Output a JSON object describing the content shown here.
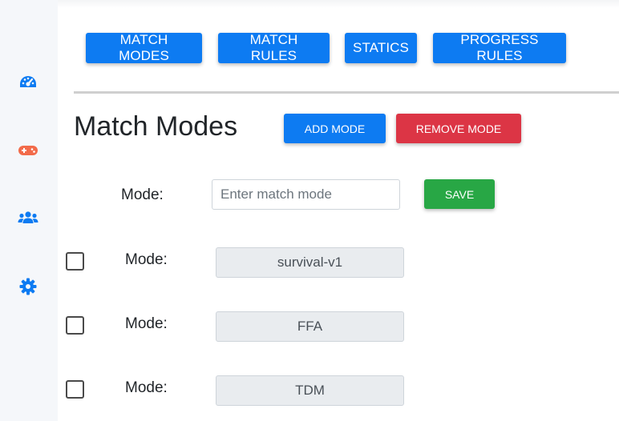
{
  "colors": {
    "primary": "#0d7bf2",
    "danger": "#dc3545",
    "success": "#28a745",
    "sidebar_icon_blue": "#0d7bf2",
    "sidebar_icon_orange": "#f26b4a"
  },
  "sidebar": {
    "items": [
      {
        "icon": "speedometer-icon"
      },
      {
        "icon": "gamepad-icon"
      },
      {
        "icon": "users-icon"
      },
      {
        "icon": "gear-icon"
      }
    ]
  },
  "nav": {
    "match_modes": "MATCH MODES",
    "match_rules": "MATCH RULES",
    "statics": "STATICS",
    "progress_rules": "PROGRESS RULES"
  },
  "page": {
    "title": "Match Modes",
    "add_mode": "ADD MODE",
    "remove_mode": "REMOVE MODE"
  },
  "form": {
    "label": "Mode:",
    "placeholder": "Enter match mode",
    "value": "",
    "save": "SAVE"
  },
  "modes": [
    {
      "label": "Mode:",
      "value": "survival-v1",
      "checked": false
    },
    {
      "label": "Mode:",
      "value": "FFA",
      "checked": false
    },
    {
      "label": "Mode:",
      "value": "TDM",
      "checked": false
    }
  ]
}
